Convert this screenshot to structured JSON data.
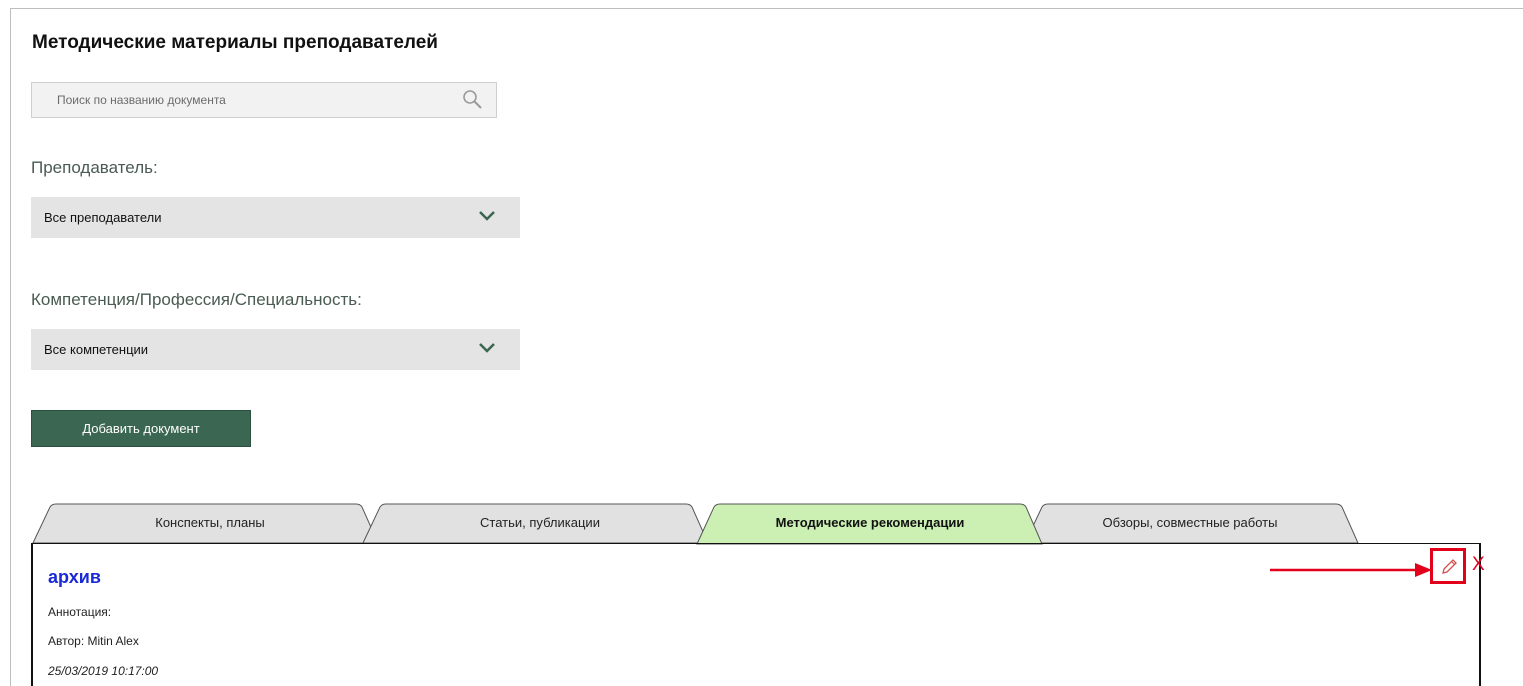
{
  "page": {
    "title": "Методические материалы преподавателей"
  },
  "search": {
    "placeholder": "Поиск по названию документа"
  },
  "filters": {
    "teacher_label": "Преподаватель:",
    "teacher_value": "Все преподаватели",
    "competence_label": "Компетенция/Профессия/Специальность:",
    "competence_value": "Все компетенции"
  },
  "actions": {
    "add_document": "Добавить документ"
  },
  "tabs": [
    {
      "label": "Конспекты, планы",
      "active": false
    },
    {
      "label": "Статьи, публикации",
      "active": false
    },
    {
      "label": "Методические рекомендации",
      "active": true
    },
    {
      "label": "Обзоры, совместные работы",
      "active": false
    }
  ],
  "document": {
    "title": "архив",
    "annotation_label": "Аннотация:",
    "author_line": "Автор:  Mitin Alex",
    "date": "25/03/2019 10:17:00",
    "delete_label": "X"
  },
  "colors": {
    "accent_button": "#3b6651",
    "active_tab": "#ccefb4",
    "inactive_tab": "#e1e1e1",
    "link": "#1a2bd6",
    "annotation": "#e3001b"
  }
}
